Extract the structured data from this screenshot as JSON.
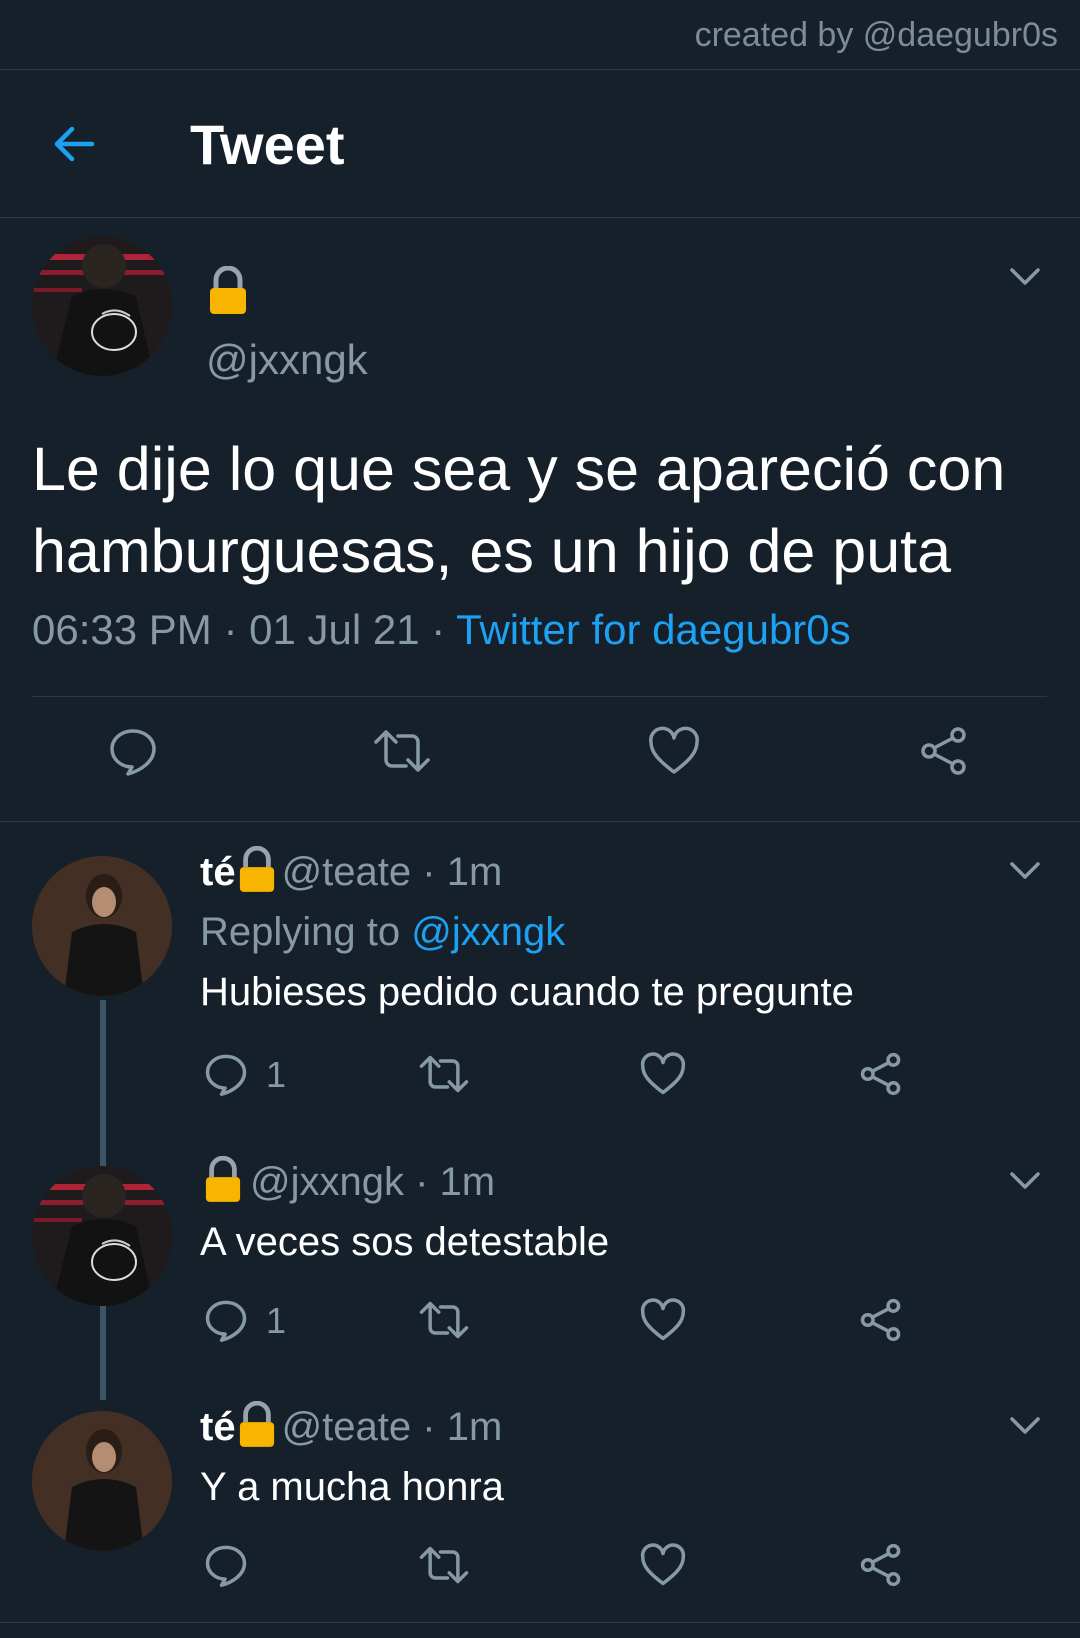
{
  "credit": "created by @daegubr0s",
  "header": {
    "title": "Tweet",
    "back_icon": "arrow-left-icon",
    "accent": "#1da1f2"
  },
  "main_tweet": {
    "handle": "@jxxngk",
    "text": "Le dije lo que sea y se apareció con hamburguesas, es un hijo de puta",
    "time": "06:33 PM · 01 Jul 21 · ",
    "source": "Twitter for daegubr0s"
  },
  "replies": [
    {
      "display_name": "té",
      "handle": "@teate · 1m",
      "replying_prefix": "Replying to ",
      "replying_to": "@jxxngk",
      "text": "Hubieses pedido cuando te pregunte",
      "reply_count": "1"
    },
    {
      "display_name": "",
      "handle": "@jxxngk · 1m",
      "text": "A veces sos detestable",
      "reply_count": "1"
    },
    {
      "display_name": "té",
      "handle": "@teate · 1m",
      "text": "Y a mucha honra",
      "reply_count": ""
    }
  ],
  "colors": {
    "background": "#15202b",
    "muted": "#8899a6",
    "link": "#1da1f2",
    "lock": "#f7b500"
  }
}
